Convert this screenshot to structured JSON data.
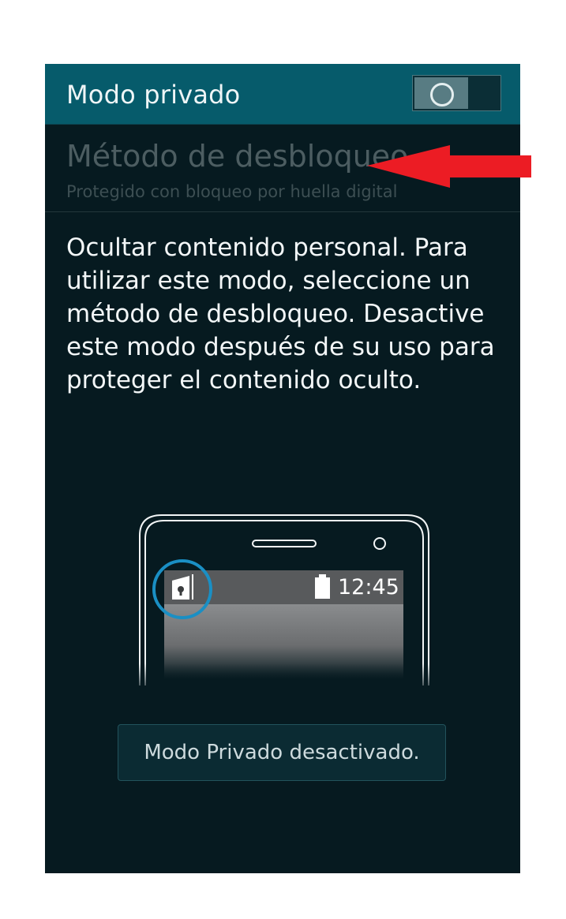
{
  "header": {
    "title": "Modo privado",
    "toggle_on": false
  },
  "setting": {
    "title": "Método de desbloqueo",
    "subtitle": "Protegido con bloqueo por huella digital"
  },
  "description": "Ocultar contenido personal. Para utilizar este modo, seleccione un método de desbloqueo. Desactive este modo después de su uso para proteger el contenido oculto.",
  "illustration": {
    "clock": "12:45",
    "icons": [
      "private-mode-lock-icon",
      "battery-icon"
    ]
  },
  "button": {
    "label": "Modo Privado desactivado."
  },
  "colors": {
    "header_bg": "#065b6b",
    "screen_bg": "#061a20",
    "highlight_ring": "#1a8fc4",
    "arrow": "#ec1c24"
  }
}
